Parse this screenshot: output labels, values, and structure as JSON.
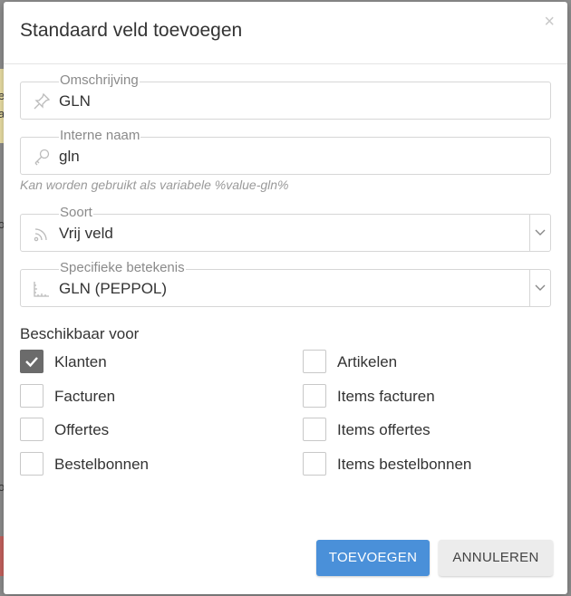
{
  "background": {
    "letter_a": "e",
    "letter_b": "a",
    "letter_c": "o",
    "letter_d": "o"
  },
  "modal": {
    "title": "Standaard veld toevoegen",
    "close_glyph": "×"
  },
  "fields": {
    "description": {
      "label": "Omschrijving",
      "value": "GLN",
      "icon": "pushpin-icon"
    },
    "internal_name": {
      "label": "Interne naam",
      "value": "gln",
      "icon": "key-icon"
    },
    "hint": "Kan worden gebruikt als variabele %value-gln%",
    "kind": {
      "label": "Soort",
      "value": "Vrij veld",
      "icon": "rss-icon"
    },
    "meaning": {
      "label": "Specifieke betekenis",
      "value": "GLN (PEPPOL)",
      "icon": "ruler-icon"
    }
  },
  "availability": {
    "title": "Beschikbaar voor",
    "items": [
      {
        "label": "Klanten",
        "checked": true
      },
      {
        "label": "Artikelen",
        "checked": false
      },
      {
        "label": "Facturen",
        "checked": false
      },
      {
        "label": "Items facturen",
        "checked": false
      },
      {
        "label": "Offertes",
        "checked": false
      },
      {
        "label": "Items offertes",
        "checked": false
      },
      {
        "label": "Bestelbonnen",
        "checked": false
      },
      {
        "label": "Items bestelbonnen",
        "checked": false
      }
    ]
  },
  "buttons": {
    "submit": "TOEVOEGEN",
    "cancel": "ANNULEREN"
  },
  "colors": {
    "primary": "#4a90d9",
    "checked": "#6b6b6b"
  }
}
